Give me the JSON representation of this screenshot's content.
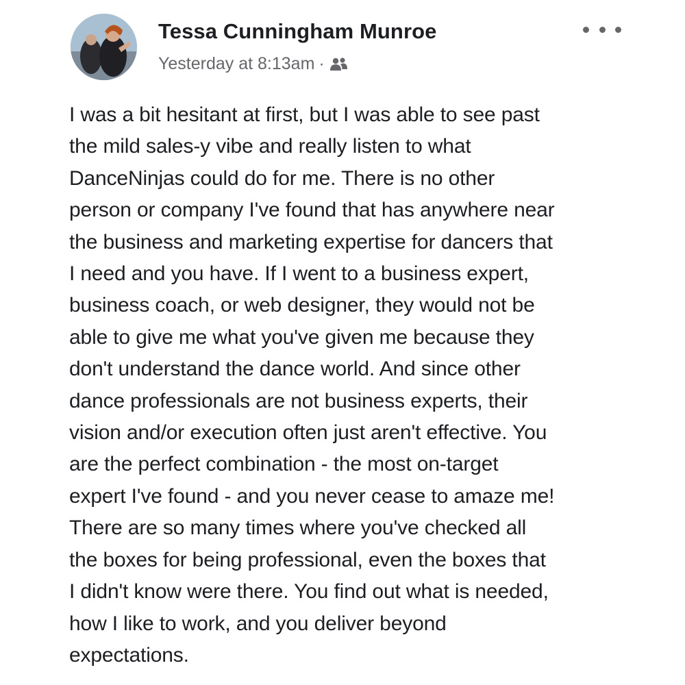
{
  "post": {
    "author": "Tessa Cunningham Munroe",
    "timestamp": "Yesterday at 8:13am",
    "separator": "·",
    "audience_icon": "friends-icon",
    "menu_icon": "more-options-icon",
    "avatar_icon": "profile-photo",
    "text": "I was a bit hesitant at first, but I was able to see past\nthe mild sales-y vibe and really listen to what\nDanceNinjas could do for me. There is no other\nperson or company I've found that has anywhere near\nthe business and marketing expertise for dancers that\nI need and you have. If I went to a business expert,\nbusiness coach, or web designer, they would not be\nable to give me what you've given me because they\ndon't understand the dance world. And since other\ndance professionals are not business experts, their\nvision and/or execution often just aren't effective. You\nare the perfect combination - the most on-target\nexpert I've found - and you never cease to amaze me!\nThere are so many times where you've checked all\nthe boxes for being professional, even the boxes that\nI didn't know were there. You find out what is needed,\nhow I like to work, and you deliver beyond\nexpectations."
  },
  "colors": {
    "text_primary": "#1c1e21",
    "text_secondary": "#65676b",
    "background": "#ffffff"
  }
}
